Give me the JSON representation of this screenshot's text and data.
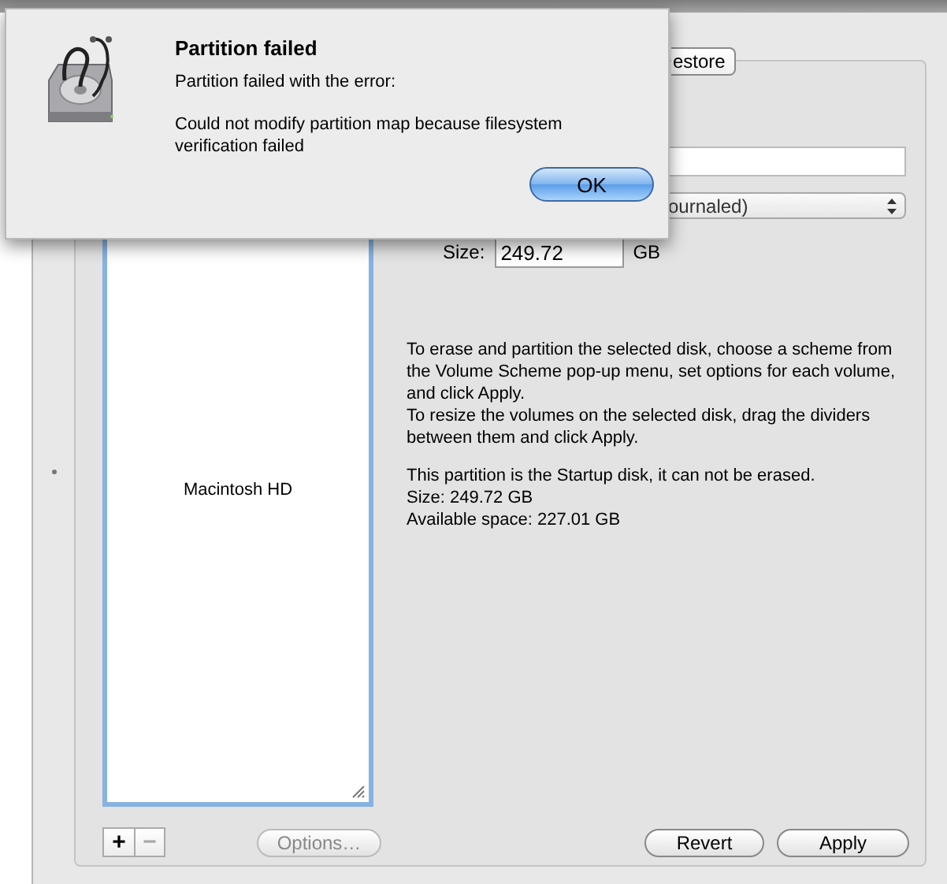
{
  "dialog": {
    "title": "Partition failed",
    "message": "Partition failed with the error:",
    "detail": "Could not modify partition map because filesystem verification failed",
    "buttons": [
      {
        "label": "OK",
        "default": true
      }
    ]
  },
  "tabs": [
    {
      "label": "estore",
      "selected": false
    }
  ],
  "volume_information": {
    "format": "ournaled)"
  },
  "size": {
    "label": "Size:",
    "value": "249.72",
    "unit": "GB"
  },
  "volumes": [
    {
      "name": "Macintosh HD"
    }
  ],
  "description": [
    "To erase and partition the selected disk, choose a scheme from the Volume Scheme pop-up menu, set options for each volume, and click Apply.",
    "To resize the volumes on the selected disk, drag the dividers between them and click Apply."
  ],
  "info": [
    "This partition is the Startup disk, it can not be erased.",
    "Size: 249.72 GB",
    "Available space: 227.01 GB"
  ],
  "volume_buttons": [
    {
      "label": "+",
      "disabled": false
    },
    {
      "label": "−",
      "disabled": true
    }
  ],
  "options_button": {
    "label": "Options…",
    "disabled": true
  },
  "actions": [
    {
      "label": "Revert"
    },
    {
      "label": "Apply"
    }
  ]
}
